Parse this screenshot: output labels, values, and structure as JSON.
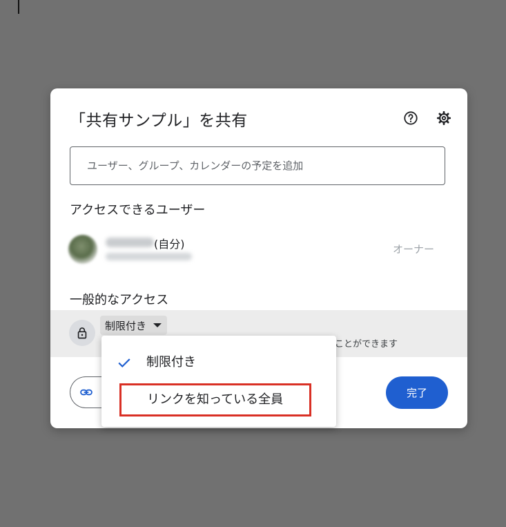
{
  "dialog": {
    "title": "「共有サンプル」を共有",
    "add_people": {
      "placeholder": "ユーザー、グループ、カレンダーの予定を追加",
      "value": ""
    },
    "people_heading": "アクセスできるユーザー",
    "owner": {
      "self_label": "(自分)",
      "role": "オーナー"
    },
    "general_access_heading": "一般的なアクセス",
    "access": {
      "selected": "制限付き",
      "description_partial": "ことができます"
    },
    "done_label": "完了"
  },
  "dropdown": {
    "options": [
      {
        "label": "制限付き",
        "checked": true
      },
      {
        "label": "リンクを知っている全員",
        "checked": false
      }
    ]
  },
  "colors": {
    "primary": "#1f5fd0",
    "highlight": "#d93025",
    "backdrop": "#717171"
  },
  "icons": [
    "help-icon",
    "settings-icon",
    "lock-icon",
    "link-icon",
    "check-icon",
    "caret-down-icon"
  ]
}
